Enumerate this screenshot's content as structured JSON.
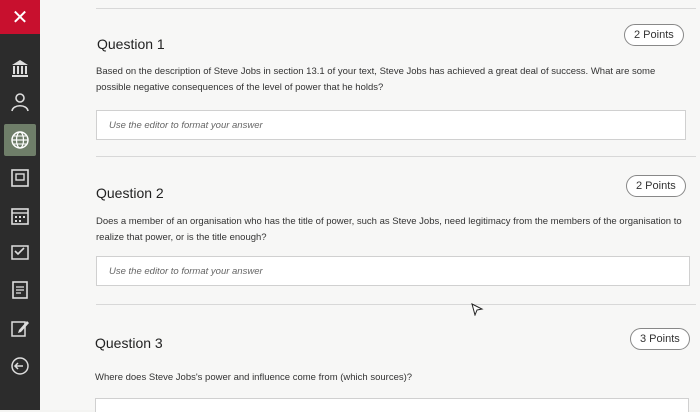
{
  "sidebar": {
    "close_label": "✕",
    "icons": [
      "institution-icon",
      "user-icon",
      "globe-icon",
      "document-icon",
      "calendar-icon",
      "grades-icon",
      "tasks-icon",
      "edit-icon",
      "logout-icon"
    ]
  },
  "questions": [
    {
      "title": "Question 1",
      "points": "2 Points",
      "text": "Based on the description of Steve Jobs in section 13.1 of your text, Steve Jobs has achieved a great deal of success. What are some possible negative consequences of the level of power that he holds?",
      "answer_placeholder": "Use the editor to format your answer"
    },
    {
      "title": "Question 2",
      "points": "2 Points",
      "text": "Does a member of an organisation who has the title of power, such as Steve Jobs, need legitimacy from the members of the organisation to realize that power, or is the title enough?",
      "answer_placeholder": "Use the editor to format your answer"
    },
    {
      "title": "Question 3",
      "points": "3 Points",
      "text": "Where does Steve Jobs's power and influence come from (which sources)?"
    }
  ],
  "colors": {
    "close": "#c8102e",
    "sidebar": "#2c2c2c",
    "active": "#6f7e69"
  }
}
